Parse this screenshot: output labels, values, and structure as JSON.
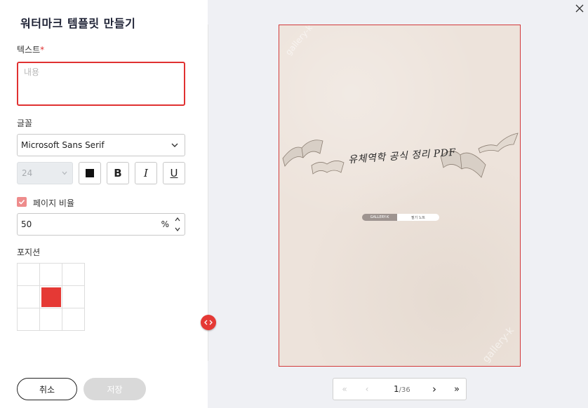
{
  "left_panel": {
    "title": "워터마크 템플릿 만들기",
    "text_label": "텍스트",
    "required_mark": "*",
    "text_placeholder": "내용",
    "font_label": "글꼴",
    "font_value": "Microsoft Sans Serif",
    "font_size": "24",
    "bold_label": "B",
    "italic_label": "I",
    "underline_label": "U",
    "page_ratio_label": "페이지 비율",
    "page_ratio_checked": true,
    "ratio_value": "50",
    "ratio_unit": "%",
    "position_label": "포지션",
    "position_selected": "center",
    "cancel_label": "취소",
    "save_label": "저장"
  },
  "preview": {
    "headline": "유체역학 공식 정리 PDF",
    "pill_left": "GALLERY-K",
    "pill_right": "필기 노트",
    "watermark_text": "gallery-k"
  },
  "pager": {
    "first": "«",
    "prev": "‹",
    "current": "1",
    "total": "/36",
    "next": "›",
    "last": "»"
  },
  "colors": {
    "accent": "#e53935",
    "page_bg": "#ede3db",
    "panel_bg": "#eff0f4"
  }
}
